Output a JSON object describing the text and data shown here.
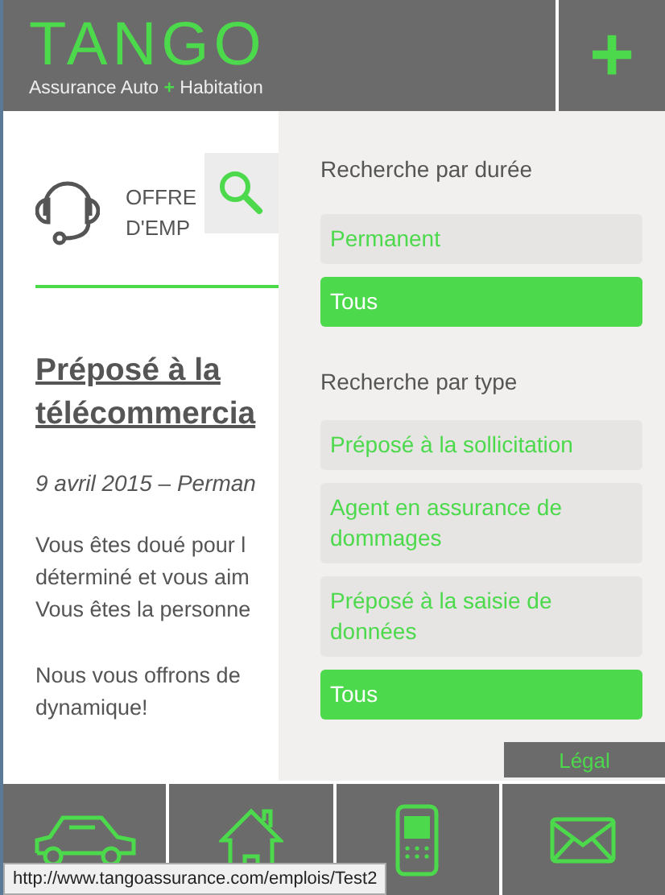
{
  "header": {
    "logo": "TANGO",
    "tagline_parts": [
      "Assurance Auto",
      "+",
      "Habitation"
    ],
    "menu_button": "+"
  },
  "page": {
    "section_lines": [
      "OFFRE",
      "D'EMP"
    ],
    "job_title_lines": [
      "Préposé à la",
      "télécommercia"
    ],
    "meta": "9 avril 2015 – Perman",
    "paragraphs": [
      [
        "Vous êtes doué pour l",
        "déterminé et vous aim",
        "Vous êtes la personne"
      ],
      [
        "Nous vous offrons de",
        "dynamique!"
      ]
    ]
  },
  "filter_panel": {
    "groups": [
      {
        "heading": "Recherche par durée",
        "options": [
          {
            "label": "Permanent",
            "selected": false
          },
          {
            "label": "Tous",
            "selected": true
          }
        ]
      },
      {
        "heading": "Recherche par type",
        "options": [
          {
            "label": "Préposé à la sollicitation",
            "selected": false
          },
          {
            "label": "Agent en assurance de dommages",
            "selected": false
          },
          {
            "label": "Préposé à la saisie de données",
            "selected": false
          },
          {
            "label": "Tous",
            "selected": true
          }
        ]
      }
    ]
  },
  "legal_link": "Légal",
  "footer_tiles": [
    {
      "kind": "car"
    },
    {
      "kind": "house"
    },
    {
      "kind": "phone"
    },
    {
      "kind": "mail"
    }
  ],
  "status_bar": "http://www.tangoassurance.com/emplois/Test2"
}
